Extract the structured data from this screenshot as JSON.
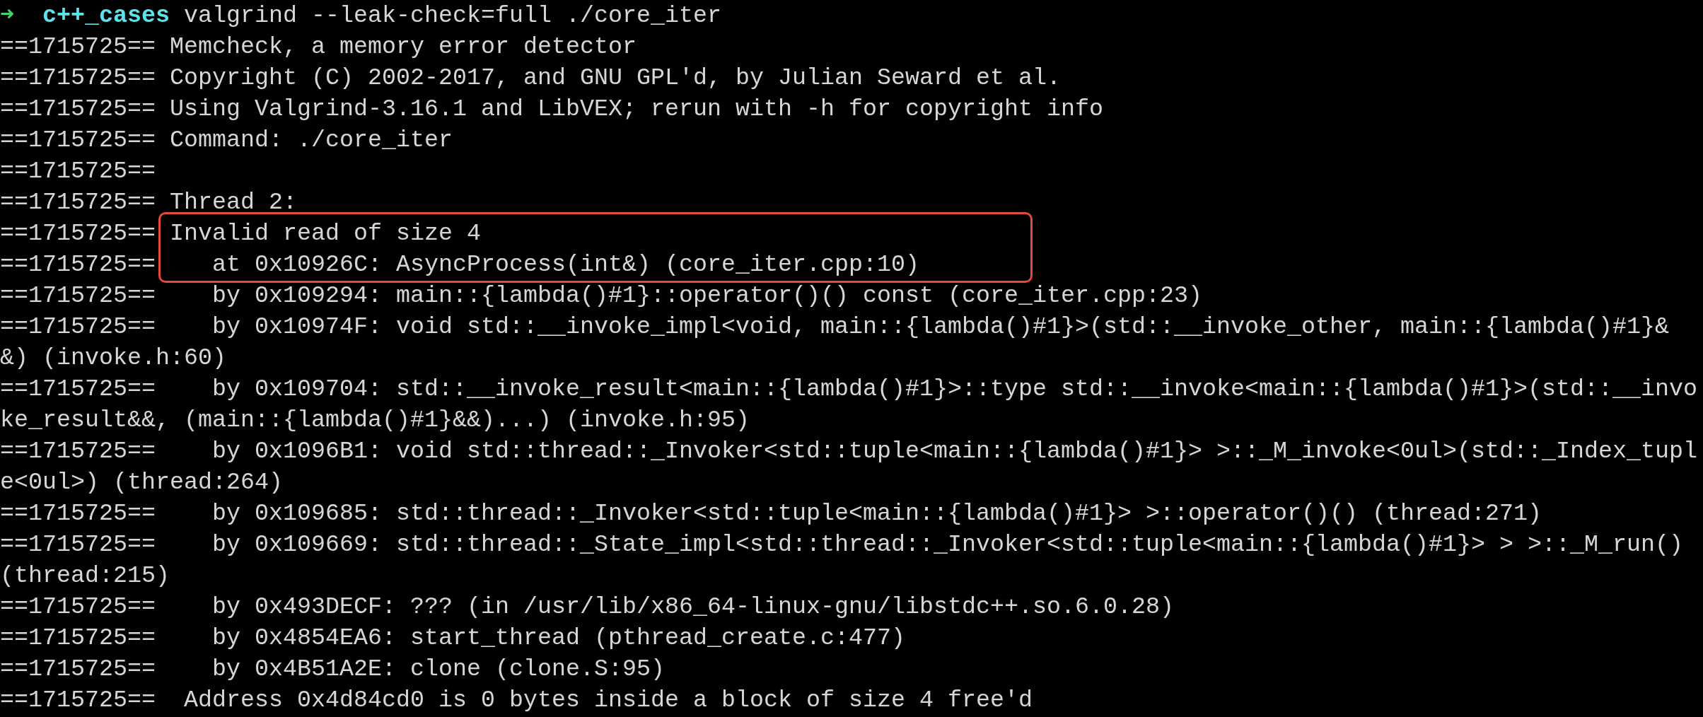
{
  "prompt": {
    "arrow": "➜",
    "directory": "c++_cases",
    "command": "valgrind --leak-check=full ./core_iter"
  },
  "lines": [
    {
      "pid": "==1715725==",
      "message": "Memcheck, a memory error detector",
      "highlighted": false
    },
    {
      "pid": "==1715725==",
      "message": "Copyright (C) 2002-2017, and GNU GPL'd, by Julian Seward et al.",
      "highlighted": false
    },
    {
      "pid": "==1715725==",
      "message": "Using Valgrind-3.16.1 and LibVEX; rerun with -h for copyright info",
      "highlighted": false
    },
    {
      "pid": "==1715725==",
      "message": "Command: ./core_iter",
      "highlighted": false
    },
    {
      "pid": "==1715725==",
      "highlighted": false
    },
    {
      "pid": "==1715725==",
      "message": "Thread 2:",
      "highlighted": false
    },
    {
      "pid": "==1715725==",
      "message": "Invalid read of size 4",
      "highlighted": true
    },
    {
      "pid": "==1715725==",
      "message": "   at 0x10926C: AsyncProcess(int&) (core_iter.cpp:10)",
      "highlighted": true
    },
    {
      "pid": "==1715725==",
      "message": "   by 0x109294: main::{lambda()#1}::operator()() const (core_iter.cpp:23)",
      "highlighted": false
    },
    {
      "pid": "==1715725==",
      "message": "   by 0x10974F: void std::__invoke_impl<void, main::{lambda()#1}>(std::__invoke_other, main::{lambda()#1}&&) (invoke.h:60)",
      "highlighted": false
    },
    {
      "pid": "==1715725==",
      "message": "   by 0x109704: std::__invoke_result<main::{lambda()#1}>::type std::__invoke<main::{lambda()#1}>(std::__invoke_result&&, (main::{lambda()#1}&&)...) (invoke.h:95)",
      "highlighted": false
    },
    {
      "pid": "==1715725==",
      "message": "   by 0x1096B1: void std::thread::_Invoker<std::tuple<main::{lambda()#1}> >::_M_invoke<0ul>(std::_Index_tuple<0ul>) (thread:264)",
      "highlighted": false
    },
    {
      "pid": "==1715725==",
      "message": "   by 0x109685: std::thread::_Invoker<std::tuple<main::{lambda()#1}> >::operator()() (thread:271)",
      "highlighted": false
    },
    {
      "pid": "==1715725==",
      "message": "   by 0x109669: std::thread::_State_impl<std::thread::_Invoker<std::tuple<main::{lambda()#1}> > >::_M_run() (thread:215)",
      "highlighted": false
    },
    {
      "pid": "==1715725==",
      "message": "   by 0x493DECF: ??? (in /usr/lib/x86_64-linux-gnu/libstdc++.so.6.0.28)",
      "highlighted": false
    },
    {
      "pid": "==1715725==",
      "message": "   by 0x4854EA6: start_thread (pthread_create.c:477)",
      "highlighted": false
    },
    {
      "pid": "==1715725==",
      "message": "   by 0x4B51A2E: clone (clone.S:95)",
      "highlighted": false
    },
    {
      "pid": "==1715725==",
      "message": " Address 0x4d84cd0 is 0 bytes inside a block of size 4 free'd",
      "highlighted": false
    }
  ]
}
